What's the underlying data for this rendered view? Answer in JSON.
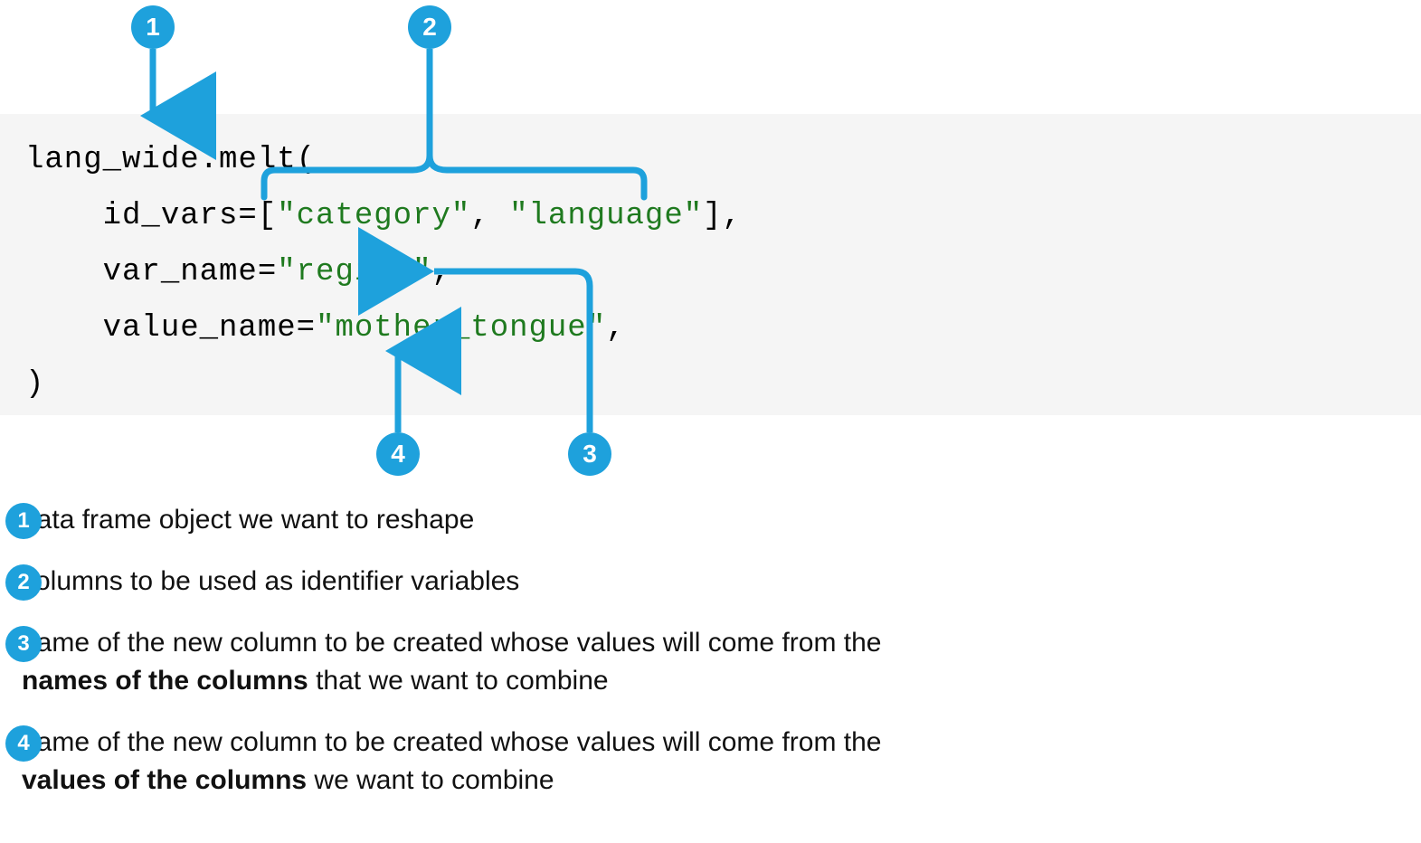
{
  "callouts": {
    "c1": "1",
    "c2": "2",
    "c3": "3",
    "c4": "4"
  },
  "code": {
    "l1a": "lang_wide",
    "l1b": ".melt(",
    "l2a": "    id_vars=[",
    "l2s1": "\"category\"",
    "l2c": ", ",
    "l2s2": "\"language\"",
    "l2e": "],",
    "l3a": "    var_name=",
    "l3s": "\"region\"",
    "l3e": ",",
    "l4a": "    value_name=",
    "l4s": "\"mother_tongue\"",
    "l4e": ",",
    "l5": ")"
  },
  "legend": {
    "i1": "data frame object we want to reshape",
    "i2": "columns to be used as identifier variables",
    "i3a": "name of the new column to be created whose values will come from the ",
    "i3b": "names of the columns",
    "i3c": " that we want to combine",
    "i4a": "name of the new column to be created whose values will come from the ",
    "i4b": "values of the columns",
    "i4c": " we want to combine"
  },
  "colors": {
    "accent": "#1ea1dc"
  }
}
